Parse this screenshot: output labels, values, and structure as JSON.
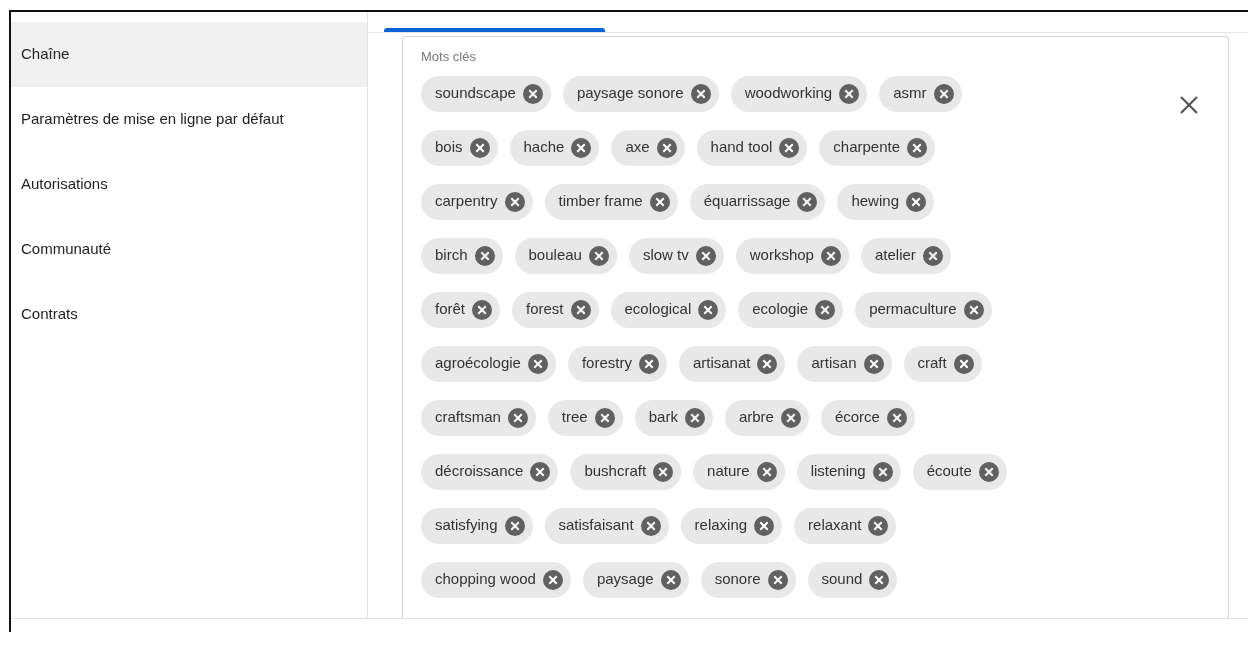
{
  "sidebar": {
    "items": [
      {
        "label": "Chaîne",
        "selected": true
      },
      {
        "label": "Paramètres de mise en ligne par défaut",
        "selected": false
      },
      {
        "label": "Autorisations",
        "selected": false
      },
      {
        "label": "Communauté",
        "selected": false
      },
      {
        "label": "Contrats",
        "selected": false
      }
    ]
  },
  "tabs": [
    {
      "selected": true
    }
  ],
  "keywords": {
    "label": "Mots clés",
    "rows": [
      [
        "soundscape",
        "paysage sonore",
        "woodworking",
        "asmr"
      ],
      [
        "bois",
        "hache",
        "axe",
        "hand tool",
        "charpente"
      ],
      [
        "carpentry",
        "timber frame",
        "équarrissage",
        "hewing"
      ],
      [
        "birch",
        "bouleau",
        "slow tv",
        "workshop",
        "atelier"
      ],
      [
        "forêt",
        "forest",
        "ecological",
        "ecologie",
        "permaculture"
      ],
      [
        "agroécologie",
        "forestry",
        "artisanat",
        "artisan",
        "craft"
      ],
      [
        "craftsman",
        "tree",
        "bark",
        "arbre",
        "écorce"
      ],
      [
        "décroissance",
        "bushcraft",
        "nature",
        "listening",
        "écoute"
      ],
      [
        "satisfying",
        "satisfaisant",
        "relaxing",
        "relaxant"
      ],
      [
        "chopping wood",
        "paysage",
        "sonore",
        "sound"
      ]
    ]
  }
}
